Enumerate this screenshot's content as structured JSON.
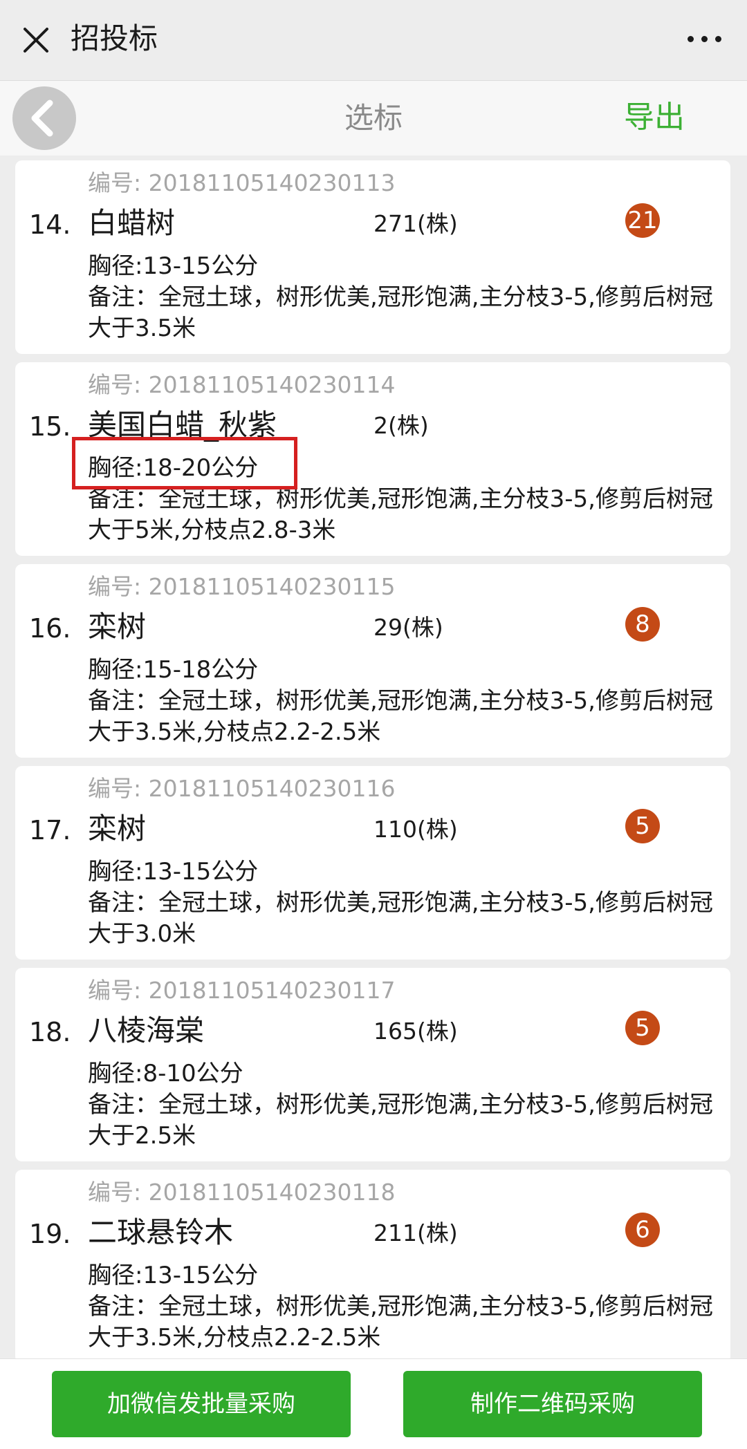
{
  "titlebar": {
    "title": "招投标"
  },
  "navbar": {
    "title": "选标",
    "export_label": "导出"
  },
  "items": [
    {
      "code": "编号: 20181105140230113",
      "index": "14.",
      "name": "白蜡树",
      "qty": "271(株)",
      "badge": "21",
      "spec": "胸径:13-15公分",
      "note": "备注：全冠土球，树形优美,冠形饱满,主分枝3-5,修剪后树冠大于3.5米"
    },
    {
      "code": "编号: 20181105140230114",
      "index": "15.",
      "name": "美国白蜡_秋紫",
      "qty": "2(株)",
      "badge": "",
      "spec": "胸径:18-20公分",
      "note": "备注：全冠土球，树形优美,冠形饱满,主分枝3-5,修剪后树冠大于5米,分枝点2.8-3米"
    },
    {
      "code": "编号: 20181105140230115",
      "index": "16.",
      "name": "栾树",
      "qty": "29(株)",
      "badge": "8",
      "spec": "胸径:15-18公分",
      "note": "备注：全冠土球，树形优美,冠形饱满,主分枝3-5,修剪后树冠大于3.5米,分枝点2.2-2.5米"
    },
    {
      "code": "编号: 20181105140230116",
      "index": "17.",
      "name": "栾树",
      "qty": "110(株)",
      "badge": "5",
      "spec": "胸径:13-15公分",
      "note": "备注：全冠土球，树形优美,冠形饱满,主分枝3-5,修剪后树冠大于3.0米"
    },
    {
      "code": "编号: 20181105140230117",
      "index": "18.",
      "name": "八棱海棠",
      "qty": "165(株)",
      "badge": "5",
      "spec": "胸径:8-10公分",
      "note": "备注：全冠土球，树形优美,冠形饱满,主分枝3-5,修剪后树冠大于2.5米"
    },
    {
      "code": "编号: 20181105140230118",
      "index": "19.",
      "name": "二球悬铃木",
      "qty": "211(株)",
      "badge": "6",
      "spec": "胸径:13-15公分",
      "note": "备注：全冠土球，树形优美,冠形饱满,主分枝3-5,修剪后树冠大于3.5米,分枝点2.2-2.5米"
    }
  ],
  "bottom": {
    "wechat_button": "加微信发批量采购",
    "qrcode_button": "制作二维码采购"
  },
  "colors": {
    "accent_green": "#2faa2b",
    "export_green": "#3cb034",
    "badge_red": "#c44a16",
    "highlight_red": "#d52020"
  }
}
